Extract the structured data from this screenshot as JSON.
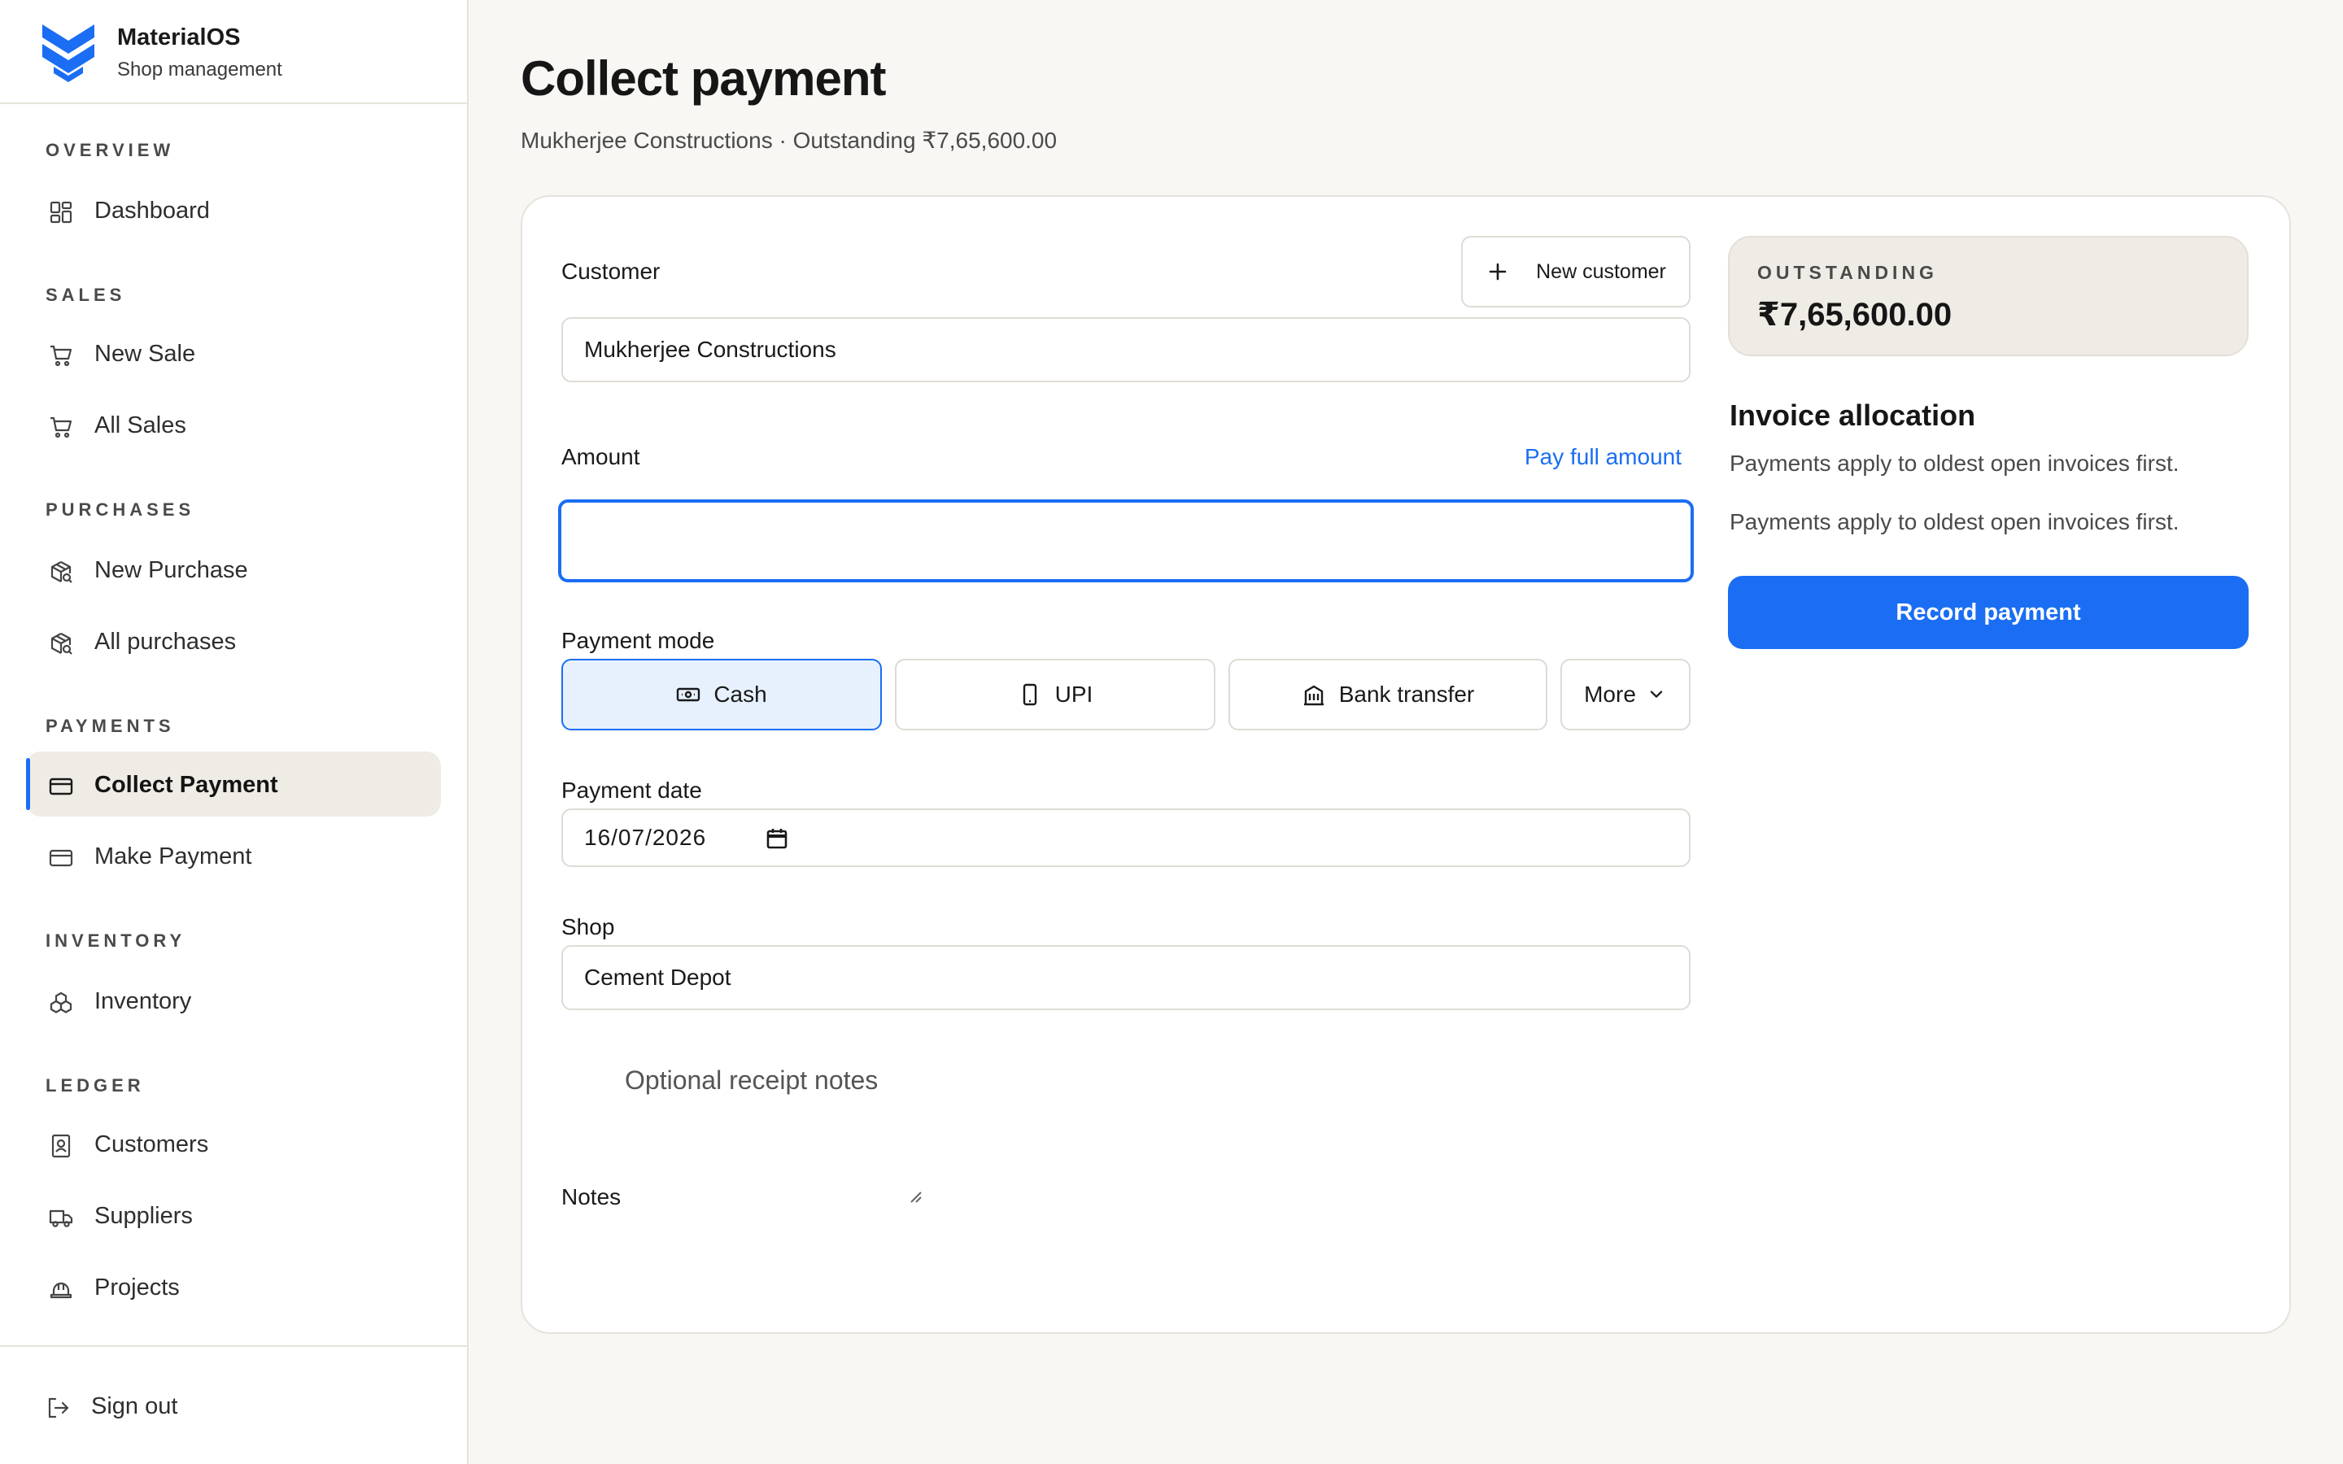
{
  "brand": {
    "name": "MaterialOS",
    "subtitle": "Shop management"
  },
  "sidebar": {
    "sections": {
      "overview": "OVERVIEW",
      "sales": "SALES",
      "purchases": "PURCHASES",
      "payments": "PAYMENTS",
      "inventory": "INVENTORY",
      "ledger": "LEDGER"
    },
    "items": {
      "dashboard": {
        "label": "Dashboard",
        "icon": "dashboard-icon"
      },
      "new_sale": {
        "label": "New Sale",
        "icon": "cart-icon"
      },
      "all_sales": {
        "label": "All Sales",
        "icon": "cart-icon"
      },
      "new_purchase": {
        "label": "New Purchase",
        "icon": "package-search-icon"
      },
      "all_purchases": {
        "label": "All purchases",
        "icon": "package-search-icon"
      },
      "collect_payment": {
        "label": "Collect Payment",
        "icon": "credit-card-icon",
        "active": true
      },
      "make_payment": {
        "label": "Make Payment",
        "icon": "credit-card-icon"
      },
      "inventory": {
        "label": "Inventory",
        "icon": "boxes-icon"
      },
      "customers": {
        "label": "Customers",
        "icon": "contact-book-icon"
      },
      "suppliers": {
        "label": "Suppliers",
        "icon": "truck-icon"
      },
      "projects": {
        "label": "Projects",
        "icon": "hard-hat-icon"
      }
    },
    "sign_out": "Sign out"
  },
  "page": {
    "title": "Collect payment",
    "subtitle": "Mukherjee Constructions · Outstanding ₹7,65,600.00"
  },
  "form": {
    "customer_label": "Customer",
    "new_customer_button": "New customer",
    "customer_value": "Mukherjee Constructions",
    "amount_label": "Amount",
    "pay_full_amount_link": "Pay full amount",
    "amount_value": "",
    "payment_mode_label": "Payment mode",
    "payment_modes": {
      "cash": "Cash",
      "upi": "UPI",
      "bank_transfer": "Bank transfer",
      "more": "More"
    },
    "selected_mode": "Cash",
    "payment_date_label": "Payment date",
    "payment_date_value": "16/07/2026",
    "shop_label": "Shop",
    "shop_value": "Cement Depot",
    "notes_placeholder": "Optional receipt notes",
    "notes_label": "Notes"
  },
  "summary": {
    "outstanding_label": "OUTSTANDING",
    "outstanding_value": "₹7,65,600.00",
    "allocation_title": "Invoice allocation",
    "allocation_text_1": "Payments apply to oldest open invoices first.",
    "allocation_text_2": "Payments apply to oldest open invoices first.",
    "record_button": "Record payment"
  },
  "colors": {
    "accent": "#1b6ef3",
    "background": "#f8f7f4",
    "selected_mode_bg": "#e7f1fd",
    "active_nav_bg": "#efece6"
  }
}
